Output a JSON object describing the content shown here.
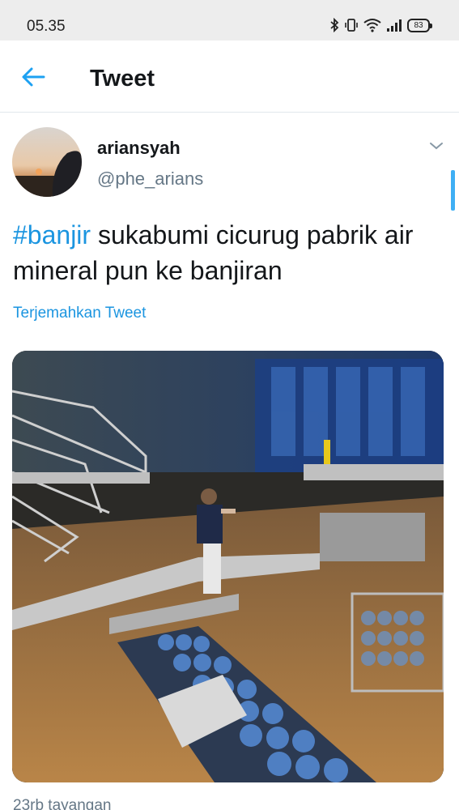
{
  "status_bar": {
    "time": "05.35",
    "battery": "83",
    "icons": [
      "bluetooth-icon",
      "vibrate-icon",
      "wifi-icon",
      "signal-icon",
      "battery-icon"
    ]
  },
  "app_bar": {
    "title": "Tweet",
    "back_icon": "arrow-left-icon"
  },
  "tweet": {
    "author_name": "ariansyah",
    "author_handle": "@phe_arians",
    "hashtag": "#banjir",
    "text": " sukabumi cicurug pabrik air mineral pun ke banjiran",
    "translate_label": "Terjemahkan Tweet",
    "views": "23rb tayangan"
  },
  "colors": {
    "accent": "#1da1f2",
    "link": "#1b95e0",
    "secondary_text": "#657786",
    "primary_text": "#14171a",
    "status_bar_bg": "#ededed"
  }
}
